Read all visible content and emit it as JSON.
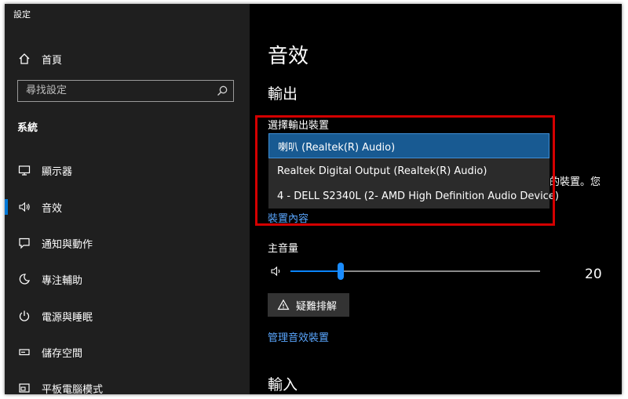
{
  "window": {
    "title": "設定"
  },
  "sidebar": {
    "home_label": "首頁",
    "search_placeholder": "尋找設定",
    "section_label": "系統",
    "items": [
      {
        "label": "顯示器",
        "icon": "monitor-icon",
        "active": false
      },
      {
        "label": "音效",
        "icon": "speaker-icon",
        "active": true
      },
      {
        "label": "通知與動作",
        "icon": "notification-icon",
        "active": false
      },
      {
        "label": "專注輔助",
        "icon": "moon-icon",
        "active": false
      },
      {
        "label": "電源與睡眠",
        "icon": "power-icon",
        "active": false
      },
      {
        "label": "儲存空間",
        "icon": "storage-icon",
        "active": false
      },
      {
        "label": "平板電腦模式",
        "icon": "tablet-icon",
        "active": false
      }
    ]
  },
  "content": {
    "page_title": "音效",
    "output_heading": "輸出",
    "select_label": "選擇輸出裝置",
    "dropdown_options": [
      {
        "label": "喇叭 (Realtek(R) Audio)",
        "selected": true
      },
      {
        "label": "Realtek Digital Output (Realtek(R) Audio)",
        "selected": false
      },
      {
        "label": "4 - DELL S2340L (2- AMD High Definition Audio Device)",
        "selected": false
      }
    ],
    "partial_text": "的裝置。您",
    "device_properties_link": "裝置內容",
    "volume_label": "主音量",
    "volume_value": "20",
    "volume_percent": 20,
    "troubleshoot_label": "疑難排解",
    "manage_devices_link": "管理音效裝置",
    "input_heading": "輸入"
  },
  "colors": {
    "sidebar_bg": "#1f1f1f",
    "content_bg": "#000000",
    "accent": "#0078d7",
    "link": "#5aa7ff",
    "highlight_border": "#d40000",
    "dropdown_selected": "#185a92"
  }
}
